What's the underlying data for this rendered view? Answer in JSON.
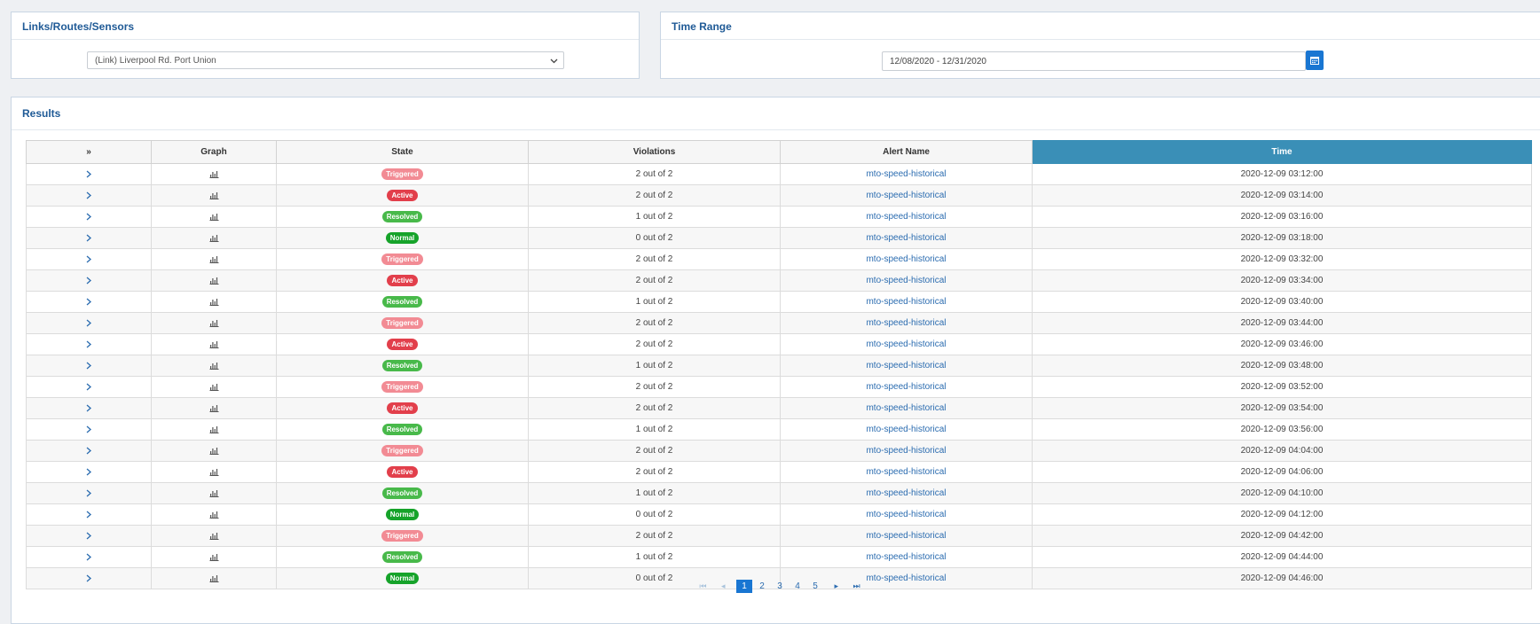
{
  "links_panel": {
    "title": "Links/Routes/Sensors",
    "selected": "(Link) Liverpool Rd. Port Union"
  },
  "time_panel": {
    "title": "Time Range",
    "value": "12/08/2020 - 12/31/2020"
  },
  "results": {
    "title": "Results",
    "columns": [
      "»",
      "Graph",
      "State",
      "Violations",
      "Alert Name",
      "Time"
    ],
    "rows": [
      {
        "state": "Triggered",
        "violations": "2 out of 2",
        "alert": "mto-speed-historical",
        "time": "2020-12-09 03:12:00"
      },
      {
        "state": "Active",
        "violations": "2 out of 2",
        "alert": "mto-speed-historical",
        "time": "2020-12-09 03:14:00"
      },
      {
        "state": "Resolved",
        "violations": "1 out of 2",
        "alert": "mto-speed-historical",
        "time": "2020-12-09 03:16:00"
      },
      {
        "state": "Normal",
        "violations": "0 out of 2",
        "alert": "mto-speed-historical",
        "time": "2020-12-09 03:18:00"
      },
      {
        "state": "Triggered",
        "violations": "2 out of 2",
        "alert": "mto-speed-historical",
        "time": "2020-12-09 03:32:00"
      },
      {
        "state": "Active",
        "violations": "2 out of 2",
        "alert": "mto-speed-historical",
        "time": "2020-12-09 03:34:00"
      },
      {
        "state": "Resolved",
        "violations": "1 out of 2",
        "alert": "mto-speed-historical",
        "time": "2020-12-09 03:40:00"
      },
      {
        "state": "Triggered",
        "violations": "2 out of 2",
        "alert": "mto-speed-historical",
        "time": "2020-12-09 03:44:00"
      },
      {
        "state": "Active",
        "violations": "2 out of 2",
        "alert": "mto-speed-historical",
        "time": "2020-12-09 03:46:00"
      },
      {
        "state": "Resolved",
        "violations": "1 out of 2",
        "alert": "mto-speed-historical",
        "time": "2020-12-09 03:48:00"
      },
      {
        "state": "Triggered",
        "violations": "2 out of 2",
        "alert": "mto-speed-historical",
        "time": "2020-12-09 03:52:00"
      },
      {
        "state": "Active",
        "violations": "2 out of 2",
        "alert": "mto-speed-historical",
        "time": "2020-12-09 03:54:00"
      },
      {
        "state": "Resolved",
        "violations": "1 out of 2",
        "alert": "mto-speed-historical",
        "time": "2020-12-09 03:56:00"
      },
      {
        "state": "Triggered",
        "violations": "2 out of 2",
        "alert": "mto-speed-historical",
        "time": "2020-12-09 04:04:00"
      },
      {
        "state": "Active",
        "violations": "2 out of 2",
        "alert": "mto-speed-historical",
        "time": "2020-12-09 04:06:00"
      },
      {
        "state": "Resolved",
        "violations": "1 out of 2",
        "alert": "mto-speed-historical",
        "time": "2020-12-09 04:10:00"
      },
      {
        "state": "Normal",
        "violations": "0 out of 2",
        "alert": "mto-speed-historical",
        "time": "2020-12-09 04:12:00"
      },
      {
        "state": "Triggered",
        "violations": "2 out of 2",
        "alert": "mto-speed-historical",
        "time": "2020-12-09 04:42:00"
      },
      {
        "state": "Resolved",
        "violations": "1 out of 2",
        "alert": "mto-speed-historical",
        "time": "2020-12-09 04:44:00"
      },
      {
        "state": "Normal",
        "violations": "0 out of 2",
        "alert": "mto-speed-historical",
        "time": "2020-12-09 04:46:00"
      }
    ]
  },
  "pagination": {
    "pages": [
      "1",
      "2",
      "3",
      "4",
      "5"
    ],
    "current": "1"
  },
  "colors": {
    "accent": "#1976d2",
    "sorted_header": "#3a8fb7",
    "Triggered": "#f28b94",
    "Active": "#e23f4b",
    "Resolved": "#48b94a",
    "Normal": "#16a32a"
  },
  "icons": {
    "expand": "chevron-right-icon",
    "graph": "bar-chart-icon",
    "calendar": "calendar-icon",
    "dropdown": "chevron-down-icon"
  }
}
